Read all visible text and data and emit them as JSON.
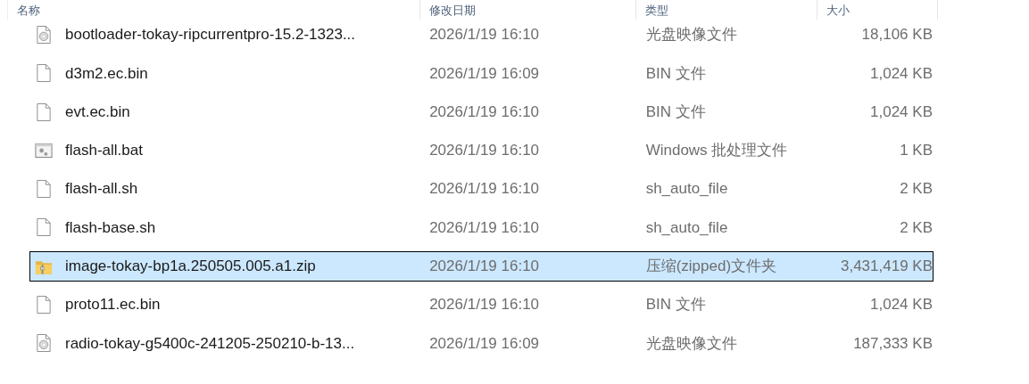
{
  "columns": [
    "名称",
    "修改日期",
    "类型",
    "大小"
  ],
  "rows": [
    {
      "kind": "disc",
      "name": "bootloader-tokay-ripcurrentpro-15.2-1323...",
      "modified": "2026/1/19 16:10",
      "type": "光盘映像文件",
      "size": "18,106 KB",
      "selected": false
    },
    {
      "kind": "file",
      "name": "d3m2.ec.bin",
      "modified": "2026/1/19 16:09",
      "type": "BIN 文件",
      "size": "1,024 KB",
      "selected": false
    },
    {
      "kind": "file",
      "name": "evt.ec.bin",
      "modified": "2026/1/19 16:10",
      "type": "BIN 文件",
      "size": "1,024 KB",
      "selected": false
    },
    {
      "kind": "batch",
      "name": "flash-all.bat",
      "modified": "2026/1/19 16:10",
      "type": "Windows 批处理文件",
      "size": "1 KB",
      "selected": false
    },
    {
      "kind": "file",
      "name": "flash-all.sh",
      "modified": "2026/1/19 16:10",
      "type": "sh_auto_file",
      "size": "2 KB",
      "selected": false
    },
    {
      "kind": "file",
      "name": "flash-base.sh",
      "modified": "2026/1/19 16:10",
      "type": "sh_auto_file",
      "size": "2 KB",
      "selected": false
    },
    {
      "kind": "zip",
      "name": "image-tokay-bp1a.250505.005.a1.zip",
      "modified": "2026/1/19 16:10",
      "type": "压缩(zipped)文件夹",
      "size": "3,431,419 KB",
      "selected": true
    },
    {
      "kind": "file",
      "name": "proto11.ec.bin",
      "modified": "2026/1/19 16:10",
      "type": "BIN 文件",
      "size": "1,024 KB",
      "selected": false
    },
    {
      "kind": "disc",
      "name": "radio-tokay-g5400c-241205-250210-b-13...",
      "modified": "2026/1/19 16:09",
      "type": "光盘映像文件",
      "size": "187,333 KB",
      "selected": false
    }
  ]
}
